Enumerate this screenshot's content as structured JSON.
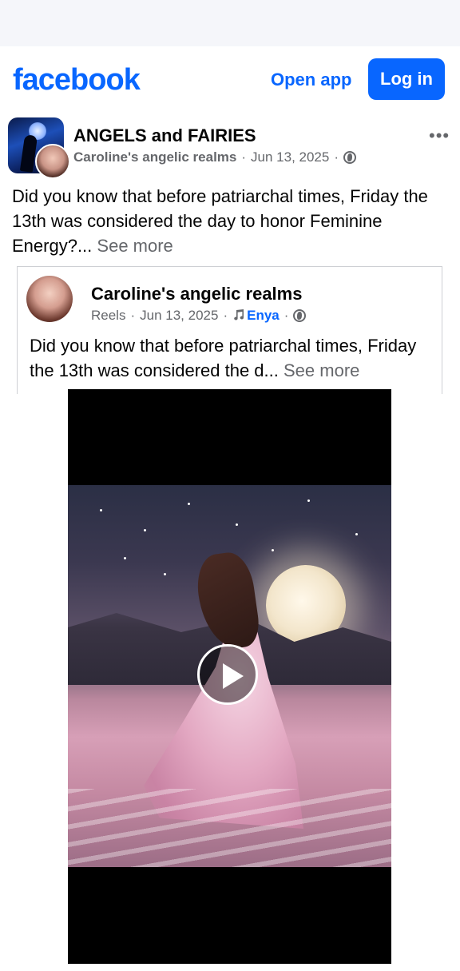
{
  "header": {
    "logo_text": "facebook",
    "open_app_label": "Open app",
    "login_label": "Log in"
  },
  "post": {
    "group_name": "ANGELS and FAIRIES",
    "author": "Caroline's angelic realms",
    "date": "Jun 13, 2025",
    "separator": "·",
    "privacy_icon": "globe-icon",
    "more_label": "•••",
    "text": "Did you know that before patriarchal times, Friday the 13th was considered the day to honor Feminine Energy?...",
    "see_more": "See more"
  },
  "shared_post": {
    "author": "Caroline's angelic realms",
    "type": "Reels",
    "date": "Jun 13, 2025",
    "separator": "·",
    "music_icon": "music-note-icon",
    "music_artist": "Enya",
    "privacy_icon": "globe-icon",
    "text": "Did you know that before patriarchal times, Friday the 13th was considered the d...",
    "see_more": "See more"
  },
  "video": {
    "play_icon": "play-icon"
  },
  "colors": {
    "brand": "#0866ff",
    "muted_text": "#65676b",
    "status_strip": "#f5f6fa"
  }
}
